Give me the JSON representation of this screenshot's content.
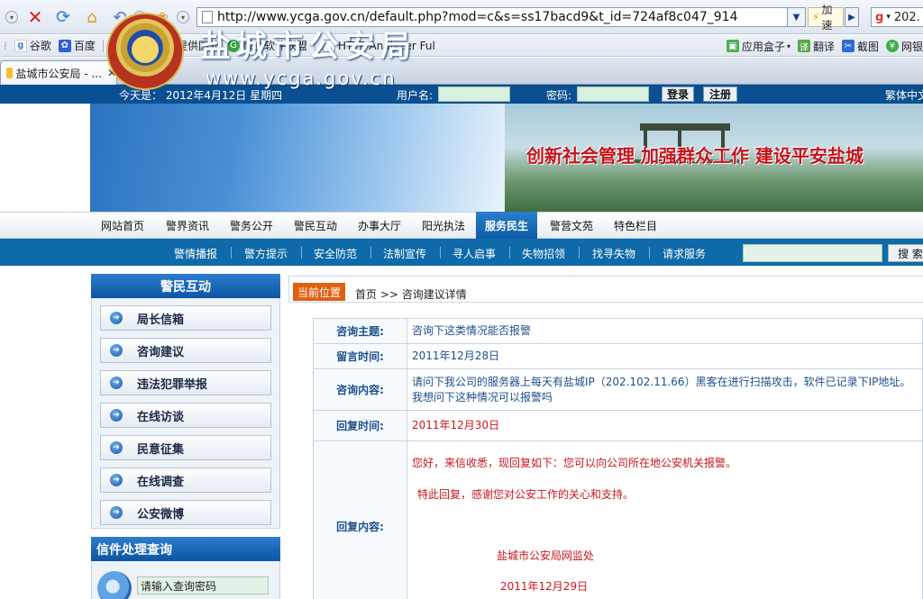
{
  "browser": {
    "url": "http://www.ycga.gov.cn/default.php?mod=c&s=ss17bacd9&t_id=724af8c047_914",
    "accel_label": "加速",
    "search_engine_text": "202.",
    "bookmarks": [
      {
        "label": "谷歌",
        "icon": "google-icon"
      },
      {
        "label": "百度",
        "icon": "baidu-icon"
      },
      {
        "label": "在线代理 -提供国外",
        "icon": "proxy-icon"
      },
      {
        "label": "绿色软件联盟",
        "icon": "software-icon"
      },
      {
        "label": "HTTP Analyzer Ful",
        "icon": "page-icon"
      }
    ],
    "bookmarks_right": [
      {
        "label": "应用盒子",
        "icon": "app-box-icon"
      },
      {
        "label": "翻译",
        "icon": "translate-icon"
      },
      {
        "label": "截图",
        "icon": "screenshot-icon"
      },
      {
        "label": "网银",
        "icon": "bank-icon"
      }
    ],
    "tab_title": "盐城市公安局 - ...",
    "tab_close": "✕",
    "new_tab": "+"
  },
  "site_bar": {
    "date_text": "今天是：  2012年4月12日 星期四",
    "username_label": "用户名:",
    "password_label": "密码:",
    "login_button": "登录",
    "register_button": "注册",
    "traditional_link": "繁体中文"
  },
  "banner": {
    "title": "盐城市公安局",
    "domain": "www.ycga.gov.cn",
    "slogan": "创新社会管理 加强群众工作 建设平安盐城"
  },
  "main_nav": {
    "items": [
      "网站首页",
      "警界资讯",
      "警务公开",
      "警民互动",
      "办事大厅",
      "阳光执法",
      "服务民生",
      "警营文苑",
      "特色栏目"
    ],
    "active_index": 6
  },
  "sub_nav": {
    "items": [
      "警情播报",
      "警方提示",
      "安全防范",
      "法制宣传",
      "寻人启事",
      "失物招领",
      "找寻失物",
      "请求服务"
    ],
    "search_button": "搜 索"
  },
  "sidebar": {
    "title": "警民互动",
    "items": [
      "局长信箱",
      "咨询建议",
      "违法犯罪举报",
      "在线访谈",
      "民意征集",
      "在线调查",
      "公安微博"
    ],
    "query_title": "信件处理查询",
    "query_placeholder": "请输入查询密码"
  },
  "content": {
    "breadcrumb_tag": "当前位置",
    "breadcrumb_path": "首页 >> 咨询建议详情",
    "rows": [
      {
        "key": "咨询主题:",
        "value": "咨询下这类情况能否报警"
      },
      {
        "key": "留言时间:",
        "value": "2011年12月28日"
      },
      {
        "key": "咨询内容:",
        "value": "请问下我公司的服务器上每天有盐城IP（202.102.11.66）黑客在进行扫描攻击，软件已记录下IP地址。我想问下这种情况可以报警吗"
      },
      {
        "key": "回复时间:",
        "value": "2011年12月30日"
      },
      {
        "key": "回复内容:",
        "value": ""
      }
    ],
    "reply": {
      "line1": "您好，来信收悉，现回复如下：您可以向公司所在地公安机关报警。",
      "line2": "特此回复，感谢您对公安工作的关心和支持。",
      "signature": "盐城市公安局网监处",
      "date": "2011年12月29日"
    }
  }
}
